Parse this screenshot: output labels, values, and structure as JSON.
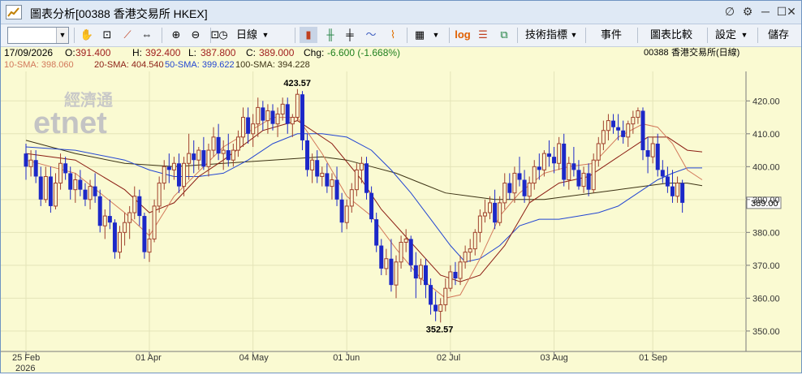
{
  "window": {
    "title": "圖表分析[00388 香港交易所 HKEX]",
    "controls": [
      "∅",
      "⚙",
      "─",
      "☐",
      "✕"
    ]
  },
  "toolbar": {
    "period_label": "日線",
    "indicators_label": "技術指標",
    "events_label": "事件",
    "compare_label": "圖表比較",
    "settings_label": "設定",
    "save_label": "儲存",
    "log_label": "log"
  },
  "info": {
    "date": "17/09/2026",
    "open_label": "O:",
    "open": "391.400",
    "high_label": "H:",
    "high": "392.400",
    "low_label": "L:",
    "low": "387.800",
    "close_label": "C:",
    "close": "389.000",
    "chg_label": "Chg:",
    "chg": "-6.600 (-1.668%)",
    "code": "00388",
    "name": "香港交易所(日線)"
  },
  "sma": {
    "sma10": "10-SMA: 398.060",
    "sma20": "20-SMA: 404.540",
    "sma50": "50-SMA: 399.622",
    "sma100": "100-SMA: 394.228"
  },
  "watermark": {
    "cn": "經濟通",
    "en": "etnet"
  },
  "colors": {
    "up": "#a0412d",
    "down": "#1c28c8",
    "bg": "#fafad2",
    "sma10": "#d2785a",
    "sma20": "#8c1e14",
    "sma50": "#2346d2",
    "sma100": "#3c3214"
  },
  "chart_data": {
    "type": "candlestick",
    "ylim": [
      347,
      426
    ],
    "yticks": [
      350,
      360,
      370,
      380,
      390,
      400,
      410,
      420
    ],
    "ytick_labels": [
      "350.00",
      "360.00",
      "370.00",
      "380.00",
      "390.00",
      "400.00",
      "410.00",
      "420.00"
    ],
    "last_price_label": "389.00",
    "last_price": 389.0,
    "high_annotation": {
      "label": "423.57",
      "value": 423.57
    },
    "low_annotation": {
      "label": "352.57",
      "value": 352.57
    },
    "x_ticks": [
      {
        "label": "25 Feb",
        "index": 0
      },
      {
        "label": "01 Apr",
        "index": 25
      },
      {
        "label": "04 May",
        "index": 46
      },
      {
        "label": "01 Jun",
        "index": 65
      },
      {
        "label": "02 Jul",
        "index": 86
      },
      {
        "label": "03 Aug",
        "index": 107
      },
      {
        "label": "01 Sep",
        "index": 127
      }
    ],
    "year_label": "2026",
    "ohlc": [
      [
        404,
        407,
        396,
        400
      ],
      [
        400,
        405,
        397,
        402
      ],
      [
        402,
        405,
        395,
        397
      ],
      [
        397,
        400,
        388,
        390
      ],
      [
        390,
        400,
        389,
        397
      ],
      [
        397,
        400,
        386,
        388
      ],
      [
        388,
        398,
        387,
        395
      ],
      [
        395,
        404,
        393,
        401
      ],
      [
        401,
        403,
        396,
        398
      ],
      [
        398,
        400,
        390,
        393
      ],
      [
        393,
        398,
        389,
        396
      ],
      [
        396,
        399,
        391,
        393
      ],
      [
        393,
        395,
        388,
        390
      ],
      [
        390,
        396,
        387,
        394
      ],
      [
        394,
        398,
        389,
        391
      ],
      [
        391,
        393,
        380,
        382
      ],
      [
        382,
        387,
        378,
        385
      ],
      [
        385,
        390,
        381,
        383
      ],
      [
        383,
        384,
        372,
        374
      ],
      [
        374,
        382,
        372,
        380
      ],
      [
        380,
        386,
        376,
        383
      ],
      [
        383,
        388,
        378,
        386
      ],
      [
        386,
        394,
        384,
        391
      ],
      [
        391,
        393,
        382,
        385
      ],
      [
        385,
        386,
        372,
        374
      ],
      [
        374,
        381,
        371,
        378
      ],
      [
        378,
        390,
        377,
        388
      ],
      [
        388,
        397,
        386,
        395
      ],
      [
        395,
        402,
        393,
        400
      ],
      [
        400,
        404,
        395,
        399
      ],
      [
        399,
        403,
        396,
        401
      ],
      [
        401,
        404,
        392,
        394
      ],
      [
        394,
        403,
        391,
        401
      ],
      [
        401,
        410,
        396,
        404
      ],
      [
        404,
        408,
        398,
        402
      ],
      [
        402,
        406,
        399,
        405
      ],
      [
        405,
        409,
        399,
        400
      ],
      [
        400,
        407,
        397,
        405
      ],
      [
        405,
        412,
        403,
        409
      ],
      [
        409,
        413,
        402,
        404
      ],
      [
        404,
        408,
        399,
        405
      ],
      [
        405,
        410,
        400,
        402
      ],
      [
        402,
        407,
        400,
        405
      ],
      [
        405,
        411,
        403,
        409
      ],
      [
        409,
        418,
        406,
        415
      ],
      [
        415,
        418,
        407,
        410
      ],
      [
        410,
        416,
        406,
        413
      ],
      [
        413,
        421,
        409,
        418
      ],
      [
        418,
        420,
        411,
        414
      ],
      [
        414,
        419,
        410,
        417
      ],
      [
        417,
        419,
        411,
        413
      ],
      [
        413,
        418,
        409,
        416
      ],
      [
        416,
        421,
        414,
        419
      ],
      [
        419,
        421,
        410,
        413
      ],
      [
        413,
        416,
        409,
        415
      ],
      [
        415,
        423.6,
        414,
        422
      ],
      [
        422,
        423,
        405,
        408
      ],
      [
        408,
        410,
        397,
        399
      ],
      [
        399,
        404,
        395,
        402
      ],
      [
        402,
        405,
        395,
        397
      ],
      [
        397,
        400,
        394,
        398
      ],
      [
        398,
        401,
        392,
        394
      ],
      [
        394,
        398,
        390,
        396
      ],
      [
        396,
        400,
        388,
        390
      ],
      [
        390,
        392,
        380,
        383
      ],
      [
        383,
        390,
        381,
        388
      ],
      [
        388,
        395,
        386,
        393
      ],
      [
        393,
        401,
        391,
        399
      ],
      [
        399,
        403,
        395,
        401
      ],
      [
        401,
        403,
        390,
        392
      ],
      [
        392,
        394,
        383,
        384
      ],
      [
        384,
        386,
        374,
        376
      ],
      [
        376,
        378,
        367,
        369
      ],
      [
        369,
        375,
        367,
        372
      ],
      [
        372,
        378,
        362,
        364
      ],
      [
        364,
        373,
        360,
        371
      ],
      [
        371,
        379,
        369,
        377
      ],
      [
        377,
        381,
        374,
        378
      ],
      [
        378,
        379,
        368,
        370
      ],
      [
        370,
        374,
        360,
        366
      ],
      [
        366,
        372,
        364,
        370
      ],
      [
        370,
        372,
        360,
        364
      ],
      [
        364,
        366,
        355,
        358
      ],
      [
        358,
        362,
        353,
        356
      ],
      [
        356,
        360,
        352.6,
        358
      ],
      [
        358,
        366,
        356,
        363
      ],
      [
        363,
        370,
        362,
        368
      ],
      [
        368,
        371,
        364,
        366
      ],
      [
        366,
        373,
        364,
        371
      ],
      [
        371,
        376,
        369,
        374
      ],
      [
        374,
        378,
        371,
        375
      ],
      [
        375,
        381,
        373,
        380
      ],
      [
        380,
        387,
        377,
        385
      ],
      [
        385,
        390,
        383,
        386
      ],
      [
        386,
        391,
        384,
        389
      ],
      [
        389,
        393,
        381,
        383
      ],
      [
        383,
        391,
        382,
        389
      ],
      [
        389,
        398,
        387,
        395
      ],
      [
        395,
        398,
        390,
        392
      ],
      [
        392,
        400,
        389,
        398
      ],
      [
        398,
        403,
        394,
        396
      ],
      [
        396,
        399,
        389,
        391
      ],
      [
        391,
        397,
        389,
        395
      ],
      [
        395,
        402,
        393,
        400
      ],
      [
        400,
        404,
        396,
        399
      ],
      [
        399,
        405,
        397,
        404
      ],
      [
        404,
        408,
        400,
        403
      ],
      [
        403,
        406,
        398,
        401
      ],
      [
        401,
        409,
        399,
        407
      ],
      [
        407,
        410,
        394,
        396
      ],
      [
        396,
        403,
        393,
        401
      ],
      [
        401,
        406,
        397,
        399
      ],
      [
        399,
        402,
        393,
        394
      ],
      [
        394,
        400,
        392,
        398
      ],
      [
        398,
        401,
        391,
        393
      ],
      [
        393,
        404,
        392,
        402
      ],
      [
        402,
        409,
        400,
        407
      ],
      [
        407,
        414,
        405,
        411
      ],
      [
        411,
        416,
        408,
        414
      ],
      [
        414,
        416,
        410,
        412
      ],
      [
        412,
        416,
        408,
        411
      ],
      [
        411,
        414,
        407,
        409
      ],
      [
        409,
        414,
        406,
        413
      ],
      [
        413,
        417,
        410,
        415
      ],
      [
        415,
        418,
        413,
        417
      ],
      [
        417,
        418,
        402,
        405
      ],
      [
        405,
        409,
        398,
        403
      ],
      [
        403,
        409,
        401,
        407
      ],
      [
        407,
        410,
        397,
        399
      ],
      [
        399,
        402,
        395,
        397
      ],
      [
        397,
        400,
        392,
        394
      ],
      [
        394,
        399,
        389,
        391
      ],
      [
        391,
        397,
        389,
        395
      ],
      [
        395,
        396,
        386,
        389
      ]
    ],
    "sma10": [
      [
        0,
        402
      ],
      [
        10,
        398
      ],
      [
        20,
        386
      ],
      [
        25,
        379
      ],
      [
        30,
        391
      ],
      [
        40,
        406
      ],
      [
        50,
        415
      ],
      [
        55,
        415
      ],
      [
        60,
        404
      ],
      [
        65,
        391
      ],
      [
        70,
        385
      ],
      [
        75,
        375
      ],
      [
        80,
        366
      ],
      [
        85,
        360
      ],
      [
        88,
        361
      ],
      [
        92,
        372
      ],
      [
        96,
        385
      ],
      [
        100,
        392
      ],
      [
        105,
        398
      ],
      [
        110,
        400
      ],
      [
        115,
        401
      ],
      [
        120,
        409
      ],
      [
        125,
        413
      ],
      [
        128,
        412
      ],
      [
        131,
        407
      ],
      [
        134,
        399
      ],
      [
        137,
        396
      ]
    ],
    "sma20": [
      [
        0,
        404
      ],
      [
        10,
        402
      ],
      [
        20,
        393
      ],
      [
        25,
        386
      ],
      [
        30,
        389
      ],
      [
        35,
        397
      ],
      [
        40,
        402
      ],
      [
        48,
        411
      ],
      [
        55,
        414
      ],
      [
        62,
        407
      ],
      [
        68,
        396
      ],
      [
        72,
        387
      ],
      [
        78,
        377
      ],
      [
        84,
        367
      ],
      [
        88,
        365
      ],
      [
        92,
        367
      ],
      [
        97,
        376
      ],
      [
        102,
        389
      ],
      [
        108,
        395
      ],
      [
        114,
        397
      ],
      [
        120,
        403
      ],
      [
        126,
        409
      ],
      [
        130,
        409
      ],
      [
        134,
        405
      ],
      [
        137,
        404.5
      ]
    ],
    "sma50": [
      [
        0,
        406
      ],
      [
        10,
        405
      ],
      [
        20,
        402
      ],
      [
        25,
        399
      ],
      [
        30,
        397
      ],
      [
        35,
        397
      ],
      [
        40,
        398
      ],
      [
        45,
        402
      ],
      [
        50,
        407
      ],
      [
        55,
        410
      ],
      [
        60,
        410
      ],
      [
        65,
        409
      ],
      [
        70,
        405
      ],
      [
        74,
        399
      ],
      [
        78,
        392
      ],
      [
        82,
        384
      ],
      [
        86,
        376
      ],
      [
        89,
        371
      ],
      [
        92,
        372
      ],
      [
        96,
        376
      ],
      [
        100,
        382
      ],
      [
        104,
        384
      ],
      [
        108,
        384
      ],
      [
        112,
        385
      ],
      [
        116,
        386
      ],
      [
        120,
        388
      ],
      [
        124,
        392
      ],
      [
        128,
        396
      ],
      [
        131,
        398
      ],
      [
        134,
        399.6
      ],
      [
        137,
        399.6
      ]
    ],
    "sma100": [
      [
        0,
        408
      ],
      [
        10,
        404
      ],
      [
        20,
        401
      ],
      [
        30,
        400
      ],
      [
        40,
        401
      ],
      [
        50,
        402
      ],
      [
        60,
        403
      ],
      [
        65,
        402
      ],
      [
        70,
        400
      ],
      [
        75,
        398
      ],
      [
        80,
        395
      ],
      [
        85,
        392
      ],
      [
        90,
        391
      ],
      [
        95,
        390
      ],
      [
        100,
        390
      ],
      [
        105,
        390
      ],
      [
        110,
        391
      ],
      [
        115,
        392
      ],
      [
        120,
        393
      ],
      [
        125,
        394
      ],
      [
        130,
        395
      ],
      [
        134,
        395
      ],
      [
        137,
        394.2
      ]
    ]
  }
}
